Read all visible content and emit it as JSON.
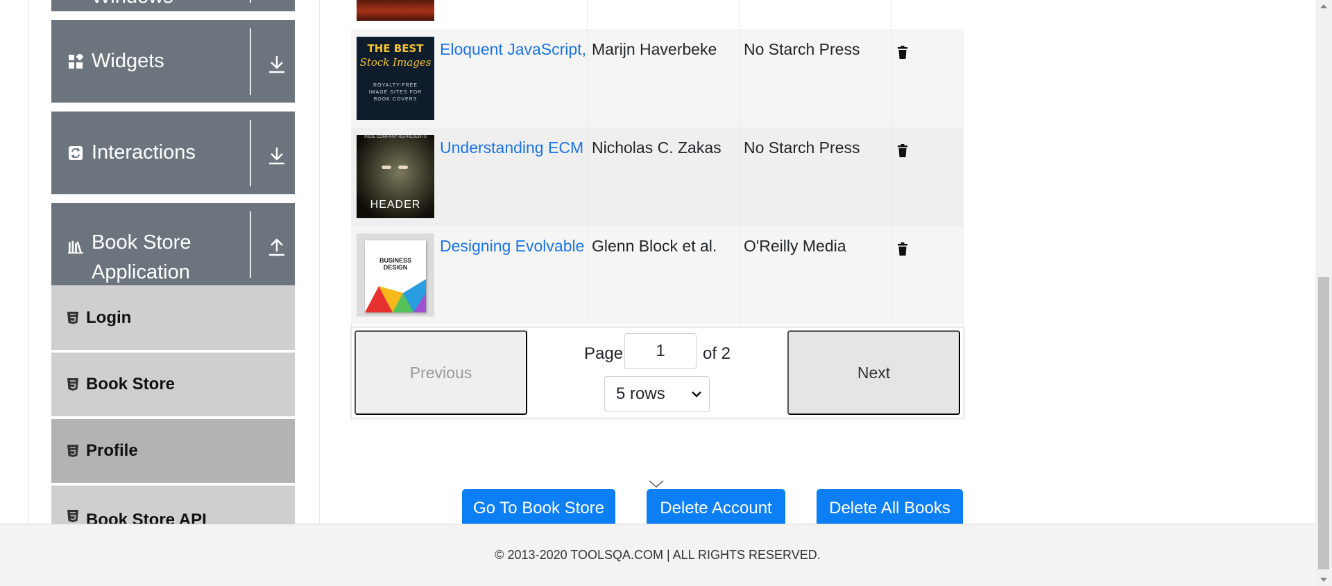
{
  "sidebar": {
    "groups": [
      {
        "label": "Windows",
        "icon": "window-icon",
        "state": "collapsed"
      },
      {
        "label": "Widgets",
        "icon": "widgets-icon",
        "state": "collapsed"
      },
      {
        "label": "Interactions",
        "icon": "interactions-icon",
        "state": "collapsed"
      },
      {
        "label_line1": "Book Store",
        "label_line2": "Application",
        "icon": "books-icon",
        "state": "expanded"
      }
    ],
    "items": [
      {
        "label": "Login",
        "icon": "html5-icon"
      },
      {
        "label": "Book Store",
        "icon": "html5-icon"
      },
      {
        "label": "Profile",
        "icon": "html5-icon",
        "active": true
      },
      {
        "label": "Book Store API",
        "icon": "html5-icon"
      }
    ]
  },
  "books": [
    {
      "title": "Eloquent JavaScript,",
      "author": "Marijn Haverbeke",
      "publisher": "No Starch Press",
      "cover_text_1": "THE BEST",
      "cover_text_2": "Stock Images",
      "cover_text_3": "ROYALTY-FREE IMAGE SITES FOR BOOK COVERS"
    },
    {
      "title": "Understanding ECM",
      "author": "Nicholas C. Zakas",
      "publisher": "No Starch Press",
      "cover_text_1": "HEADER",
      "cover_text_2": "INDIE COMPANY REPRESENTS"
    },
    {
      "title": "Designing Evolvable",
      "author": "Glenn Block et al.",
      "publisher": "O'Reilly Media",
      "cover_text_1": "BUSINESS",
      "cover_text_2": "DESIGN"
    }
  ],
  "pagination": {
    "previous_label": "Previous",
    "next_label": "Next",
    "page_label": "Page",
    "current_page": "1",
    "of_label": "of 2",
    "rows_option": "5 rows"
  },
  "actions": {
    "go_to_store": "Go To Book Store",
    "delete_account": "Delete Account",
    "delete_all_books": "Delete All Books"
  },
  "footer": {
    "text": "© 2013-2020 TOOLSQA.COM | ALL RIGHTS RESERVED."
  },
  "colors": {
    "sidebar_header": "#6c757d",
    "sidebar_item": "#cfcfcf",
    "sidebar_item_active": "#b3b3b3",
    "link": "#1a73e8",
    "primary_button": "#0d7ff5"
  }
}
